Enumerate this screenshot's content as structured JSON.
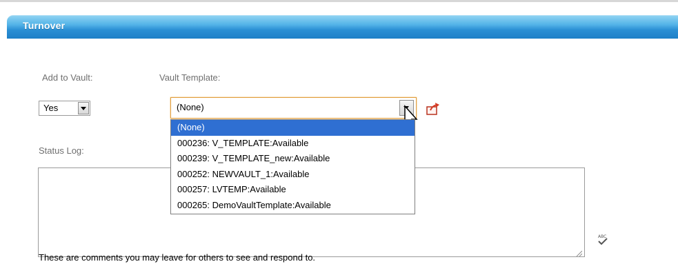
{
  "header": {
    "title": "Turnover"
  },
  "form": {
    "add_to_vault_label": "Add to Vault:",
    "add_to_vault_value": "Yes",
    "vault_template_label": "Vault Template:",
    "vault_template_value": "(None)",
    "vault_template_options": [
      "(None)",
      "000236: V_TEMPLATE:Available",
      "000239: V_TEMPLATE_new:Available",
      "000252: NEWVAULT_1:Available",
      "000257: LVTEMP:Available",
      "000265: DemoVaultTemplate:Available"
    ],
    "status_log_label": "Status Log:",
    "status_log_value": "",
    "helper_text": "These are comments you may leave for others to see and respond to."
  },
  "icons": {
    "export": "export-icon",
    "spellcheck": "spellcheck-icon",
    "dropdown_arrow": "chevron-down-icon",
    "cursor": "mouse-pointer-icon",
    "resize": "resize-grip-icon"
  },
  "colors": {
    "header_blue": "#2a8fd4",
    "focus_orange": "#e09c3b",
    "selected_option": "#2f6fd2",
    "label_gray": "#6f6f6f"
  }
}
